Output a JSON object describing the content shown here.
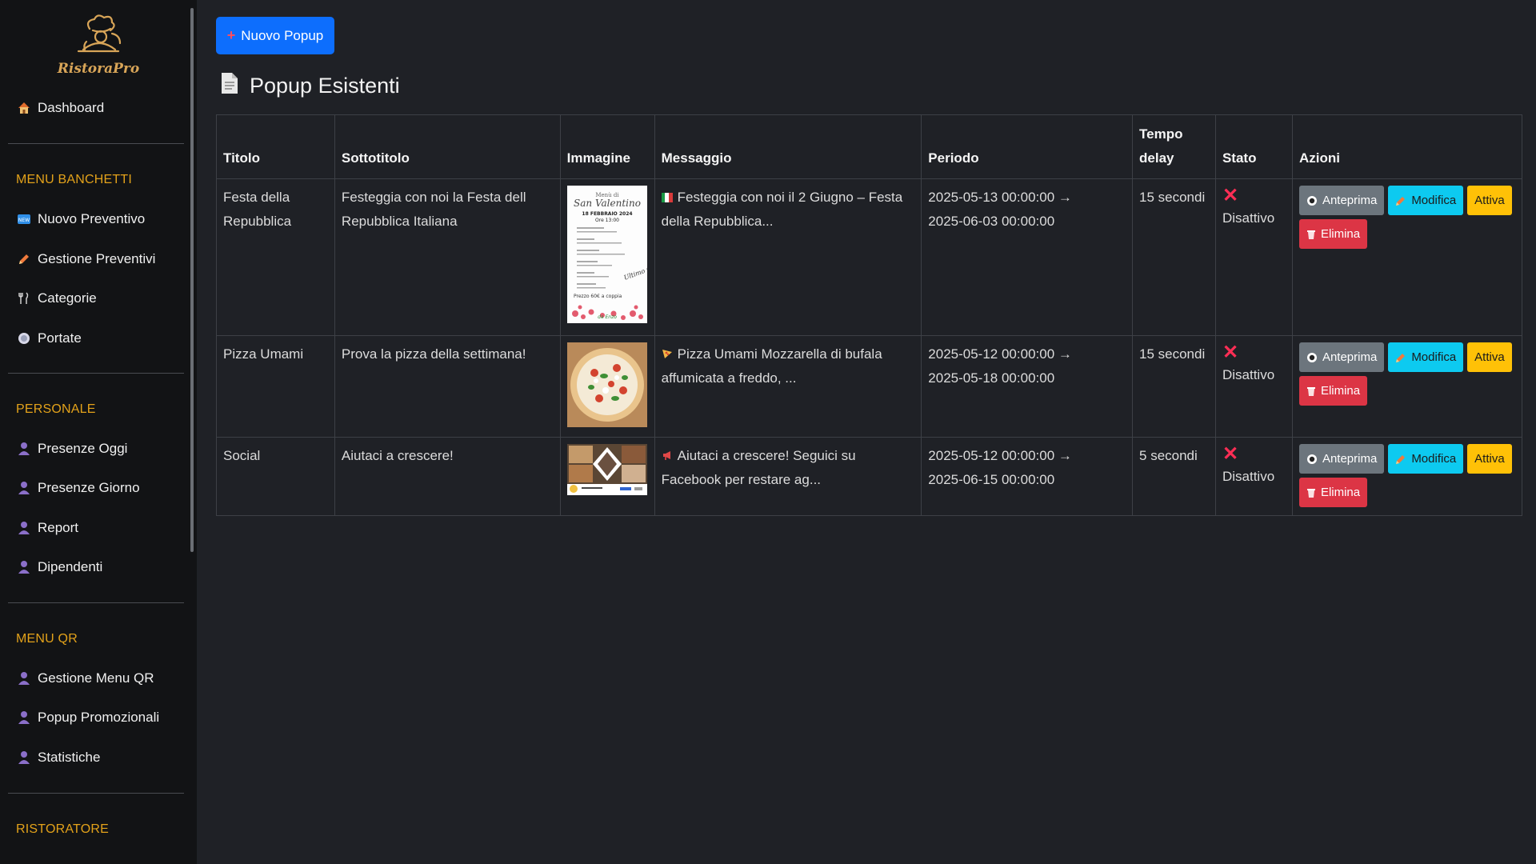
{
  "brand": {
    "name": "RistoraPro"
  },
  "sidebar": {
    "dashboard": "Dashboard",
    "sections": [
      {
        "title": "MENU BANCHETTI",
        "items": [
          "Nuovo Preventivo",
          "Gestione Preventivi",
          "Categorie",
          "Portate"
        ]
      },
      {
        "title": "PERSONALE",
        "items": [
          "Presenze Oggi",
          "Presenze Giorno",
          "Report",
          "Dipendenti"
        ]
      },
      {
        "title": "MENU QR",
        "items": [
          "Gestione Menu QR",
          "Popup Promozionali",
          "Statistiche"
        ]
      },
      {
        "title": "RISTORATORE",
        "items": []
      }
    ]
  },
  "main": {
    "new_button": "Nuovo Popup",
    "section_title": "Popup Esistenti"
  },
  "table": {
    "headers": [
      "Titolo",
      "Sottotitolo",
      "Immagine",
      "Messaggio",
      "Periodo",
      "Tempo delay",
      "Stato",
      "Azioni"
    ],
    "rows": [
      {
        "titolo": "Festa della Repubblica",
        "sottotitolo": "Festeggia con noi la Festa dell Repubblica Italiana",
        "image": "flyer",
        "messaggio": "Festeggia con noi il 2 Giugno – Festa della Repubblica...",
        "periodo_start": "2025-05-13 00:00:00 →",
        "periodo_end": "2025-06-03 00:00:00",
        "delay": "15 secondi",
        "stato": "Disattivo"
      },
      {
        "titolo": "Pizza Umami",
        "sottotitolo": "Prova la pizza della settimana!",
        "image": "pizza",
        "messaggio": "Pizza Umami Mozzarella di bufala affumicata a freddo, ...",
        "periodo_start": "2025-05-12 00:00:00 →",
        "periodo_end": "2025-05-18 00:00:00",
        "delay": "15 secondi",
        "stato": "Disattivo"
      },
      {
        "titolo": "Social",
        "sottotitolo": "Aiutaci a crescere!",
        "image": "social",
        "messaggio": "Aiutaci a crescere! Seguici su Facebook per restare ag...",
        "periodo_start": "2025-05-12 00:00:00 →",
        "periodo_end": "2025-06-15 00:00:00",
        "delay": "5 secondi",
        "stato": "Disattivo"
      }
    ],
    "actions": {
      "preview": "Anteprima",
      "edit": "Modifica",
      "activate": "Attiva",
      "delete": "Elimina"
    }
  },
  "colors": {
    "primary": "#0d6efd",
    "accent": "#e3a21a",
    "danger": "#dc3545",
    "info": "#0dcaf0",
    "warning": "#ffc107",
    "secondary": "#6c757d"
  },
  "icons": {
    "dashboard": "house-icon",
    "section_title": "document-icon",
    "status": "x-mark-icon"
  }
}
